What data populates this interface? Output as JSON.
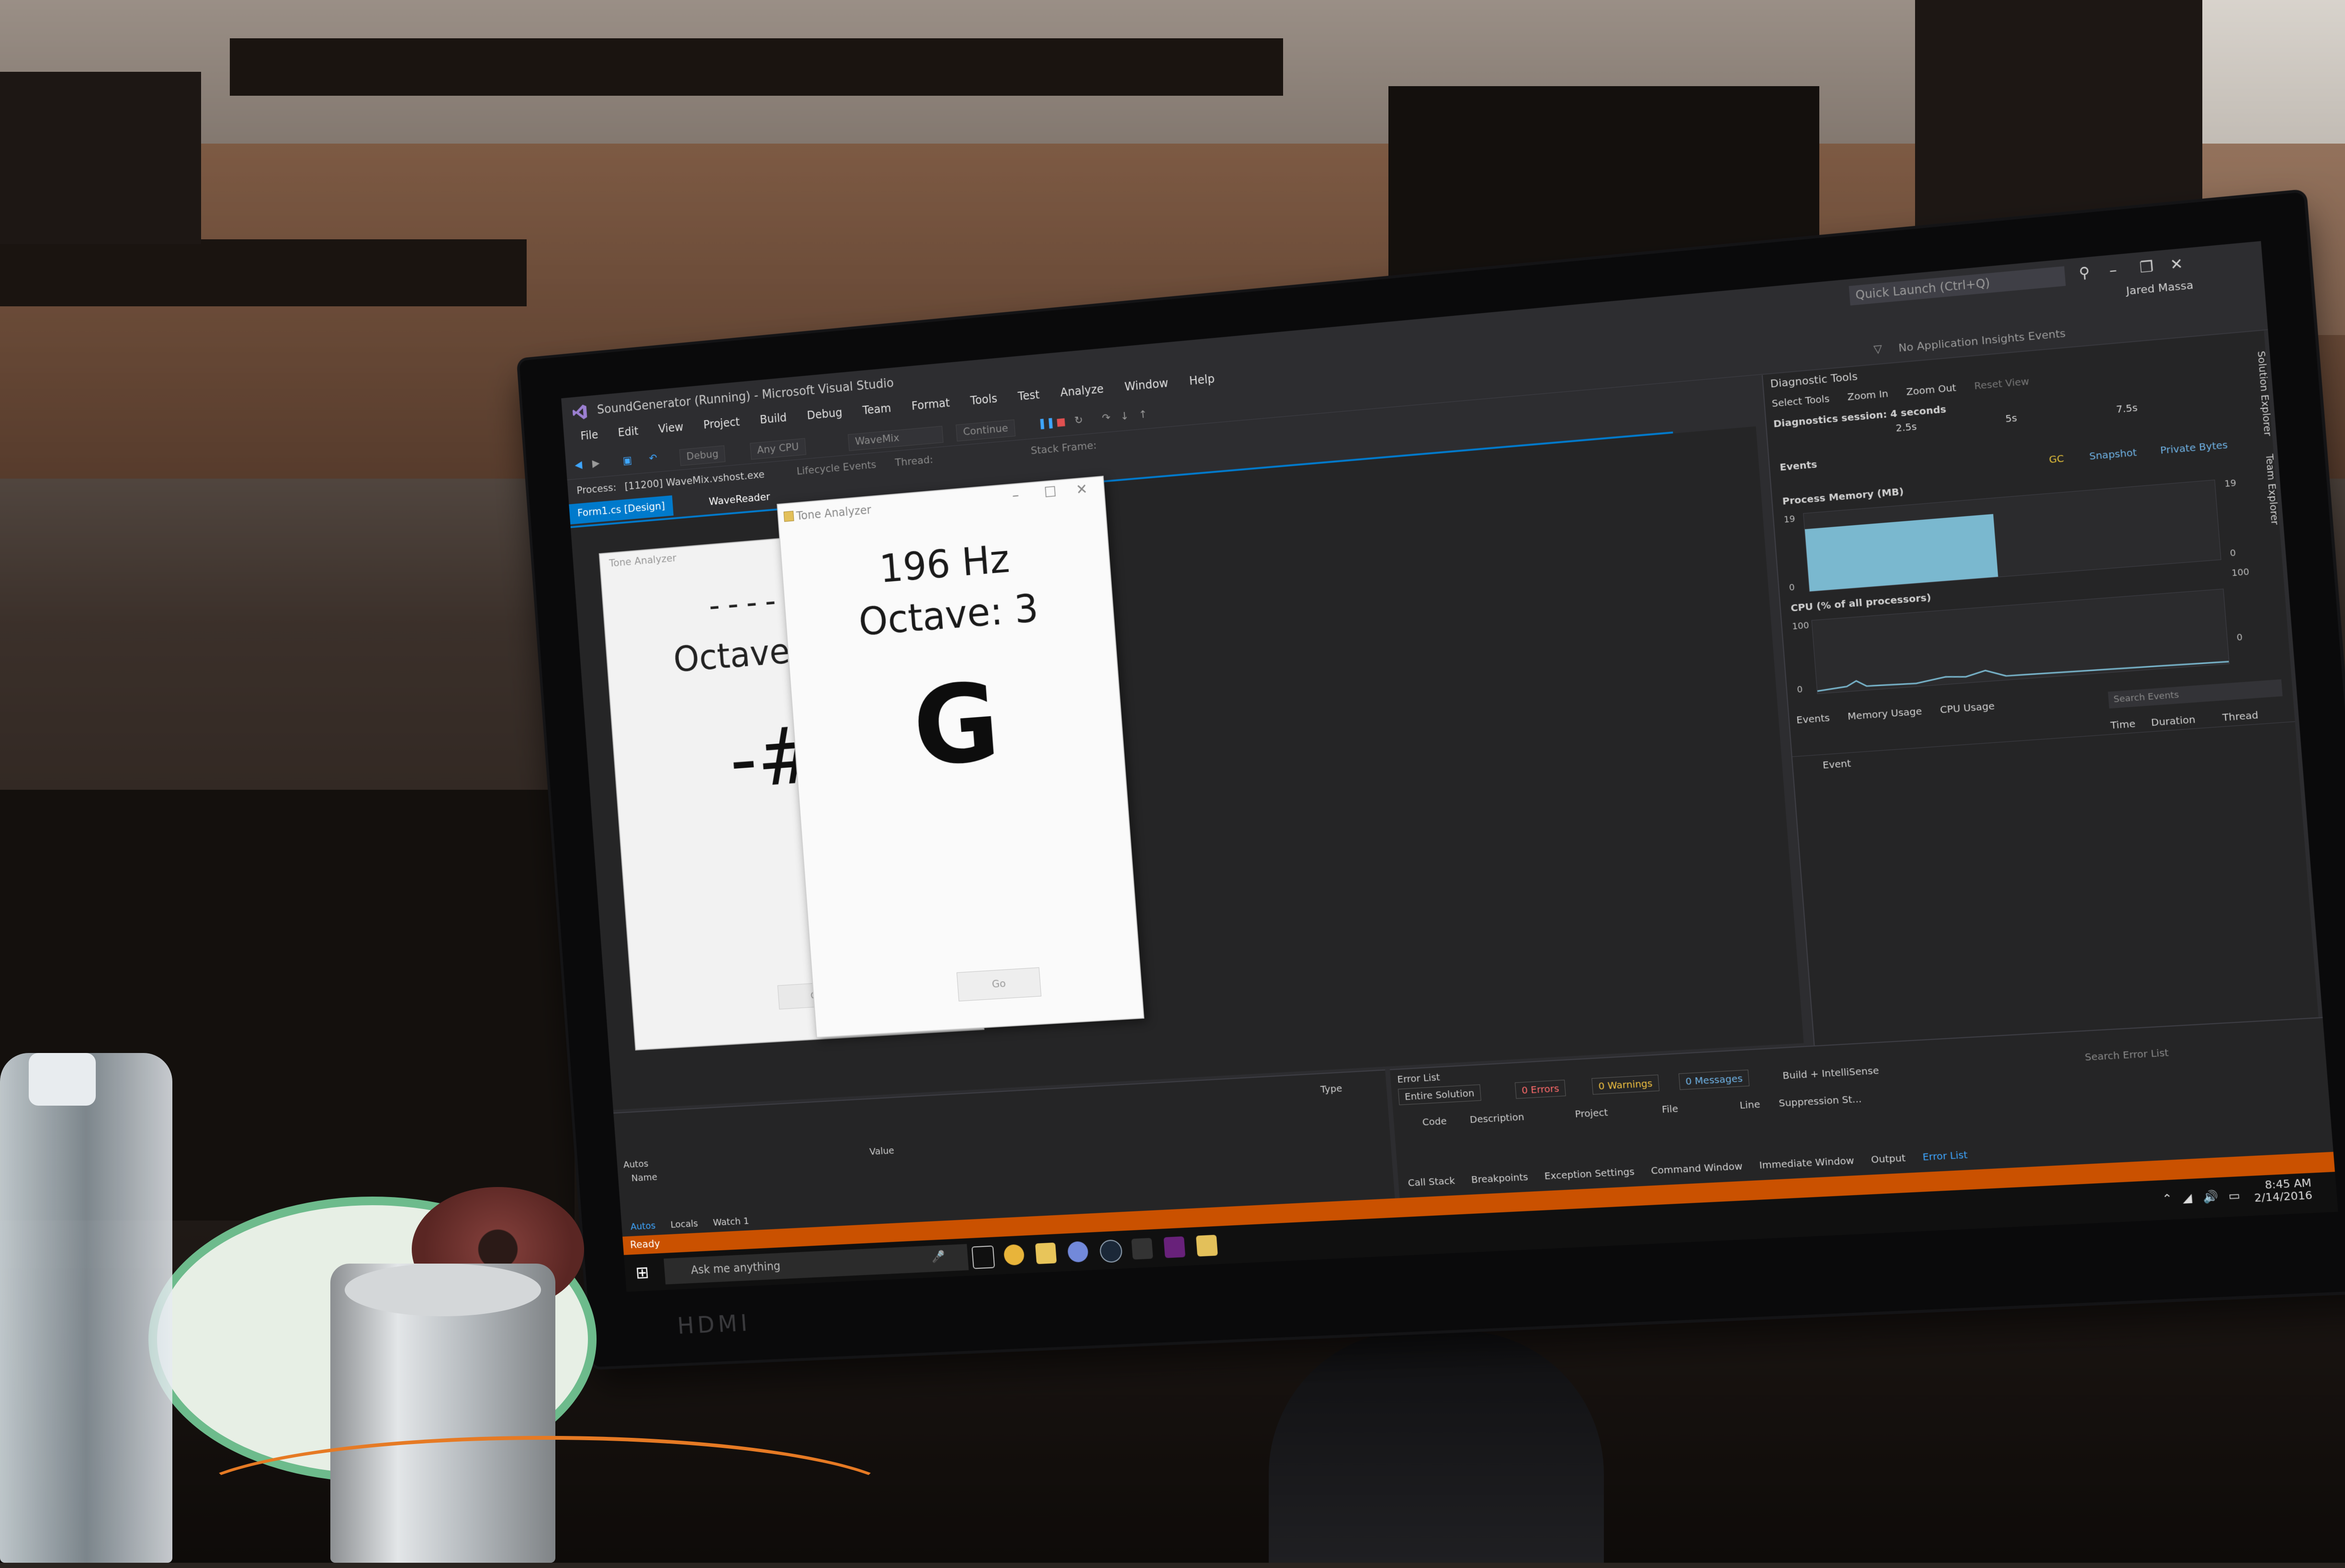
{
  "vs": {
    "window_title": "SoundGenerator (Running) - Microsoft Visual Studio",
    "quick_launch": "Quick Launch (Ctrl+Q)",
    "user": "Jared Massa",
    "menu": [
      "File",
      "Edit",
      "View",
      "Project",
      "Build",
      "Debug",
      "Team",
      "Format",
      "Tools",
      "Test",
      "Analyze",
      "Window",
      "Help"
    ],
    "toolbar": {
      "config": "Debug",
      "platform": "Any CPU",
      "startup": "WaveMix",
      "continue": "Continue",
      "lifecycle": "Lifecycle Events",
      "thread": "Thread:",
      "stack_frame": "Stack Frame:",
      "insights": "No Application Insights Events"
    },
    "process": {
      "label": "Process:",
      "value": "[11200] WaveMix.vshost.exe"
    },
    "tabs": [
      "Form1.cs [Design]",
      "WaveReader"
    ],
    "status": "Ready"
  },
  "designer_form": {
    "title": "Tone Analyzer",
    "dashes": "-----",
    "octave": "Octave",
    "note": "-#",
    "button": "Go"
  },
  "tone_analyzer": {
    "title": "Tone Analyzer",
    "frequency": "196 Hz",
    "octave": "Octave:  3",
    "note": "G",
    "button": "Go"
  },
  "diagnostics": {
    "title": "Diagnostic Tools",
    "tools": [
      "Select Tools",
      "Zoom In",
      "Zoom Out",
      "Reset View"
    ],
    "session": "Diagnostics session: 4 seconds",
    "ticks": [
      "2.5s",
      "5s",
      "7.5s"
    ],
    "events_label": "Events",
    "legend": [
      "GC",
      "Snapshot",
      "Private Bytes"
    ],
    "memory_label": "Process Memory (MB)",
    "memory_axis": [
      "19",
      "0",
      "19",
      "0"
    ],
    "cpu_label": "CPU (% of all processors)",
    "cpu_axis": [
      "100",
      "0",
      "100",
      "0"
    ],
    "tabs": [
      "Events",
      "Memory Usage",
      "CPU Usage"
    ],
    "search": "Search Events",
    "columns": [
      "Event",
      "Time",
      "Duration",
      "Thread"
    ]
  },
  "autos": {
    "title": "Autos",
    "columns": [
      "Name",
      "Value",
      "Type"
    ],
    "tabs": [
      "Autos",
      "Locals",
      "Watch 1"
    ]
  },
  "error_list": {
    "title": "Error List",
    "scope": "Entire Solution",
    "errors": "0 Errors",
    "warnings": "0 Warnings",
    "messages": "0 Messages",
    "build": "Build + IntelliSense",
    "search": "Search Error List",
    "columns": [
      "Code",
      "Description",
      "Project",
      "File",
      "Line",
      "Suppression St..."
    ],
    "tabs": [
      "Call Stack",
      "Breakpoints",
      "Exception Settings",
      "Command Window",
      "Immediate Window",
      "Output",
      "Error List"
    ]
  },
  "side_tabs": [
    "Solution Explorer",
    "Team Explorer"
  ],
  "taskbar": {
    "search": "Ask me anything",
    "time": "8:45 AM",
    "date": "2/14/2016"
  },
  "monitor": {
    "port_label": "HDMI"
  },
  "colors": {
    "vs_accent": "#007acc",
    "status_orange": "#ca5100",
    "memory_fill": "#7ab8cf"
  }
}
